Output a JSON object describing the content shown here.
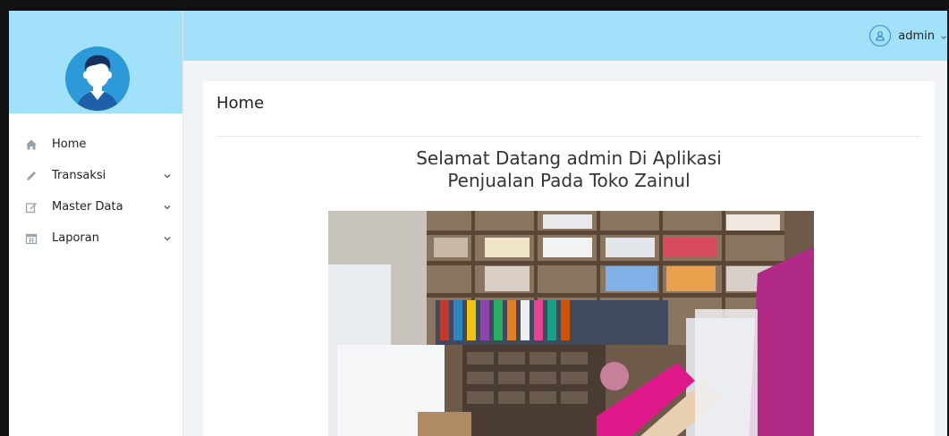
{
  "header": {
    "username": "admin"
  },
  "sidebar": {
    "items": [
      {
        "label": "Home",
        "icon": "home-icon",
        "has_submenu": false
      },
      {
        "label": "Transaksi",
        "icon": "pencil-icon",
        "has_submenu": true
      },
      {
        "label": "Master Data",
        "icon": "edit-icon",
        "has_submenu": true
      },
      {
        "label": "Laporan",
        "icon": "calendar-icon",
        "has_submenu": true
      }
    ]
  },
  "main": {
    "title": "Home",
    "welcome_line1": "Selamat Datang admin Di Aplikasi",
    "welcome_line2": "Penjualan Pada Toko Zainul"
  },
  "colors": {
    "header_bg": "#a1e2fa",
    "content_bg": "#f1f4f7",
    "user_icon": "#3a86c8"
  }
}
